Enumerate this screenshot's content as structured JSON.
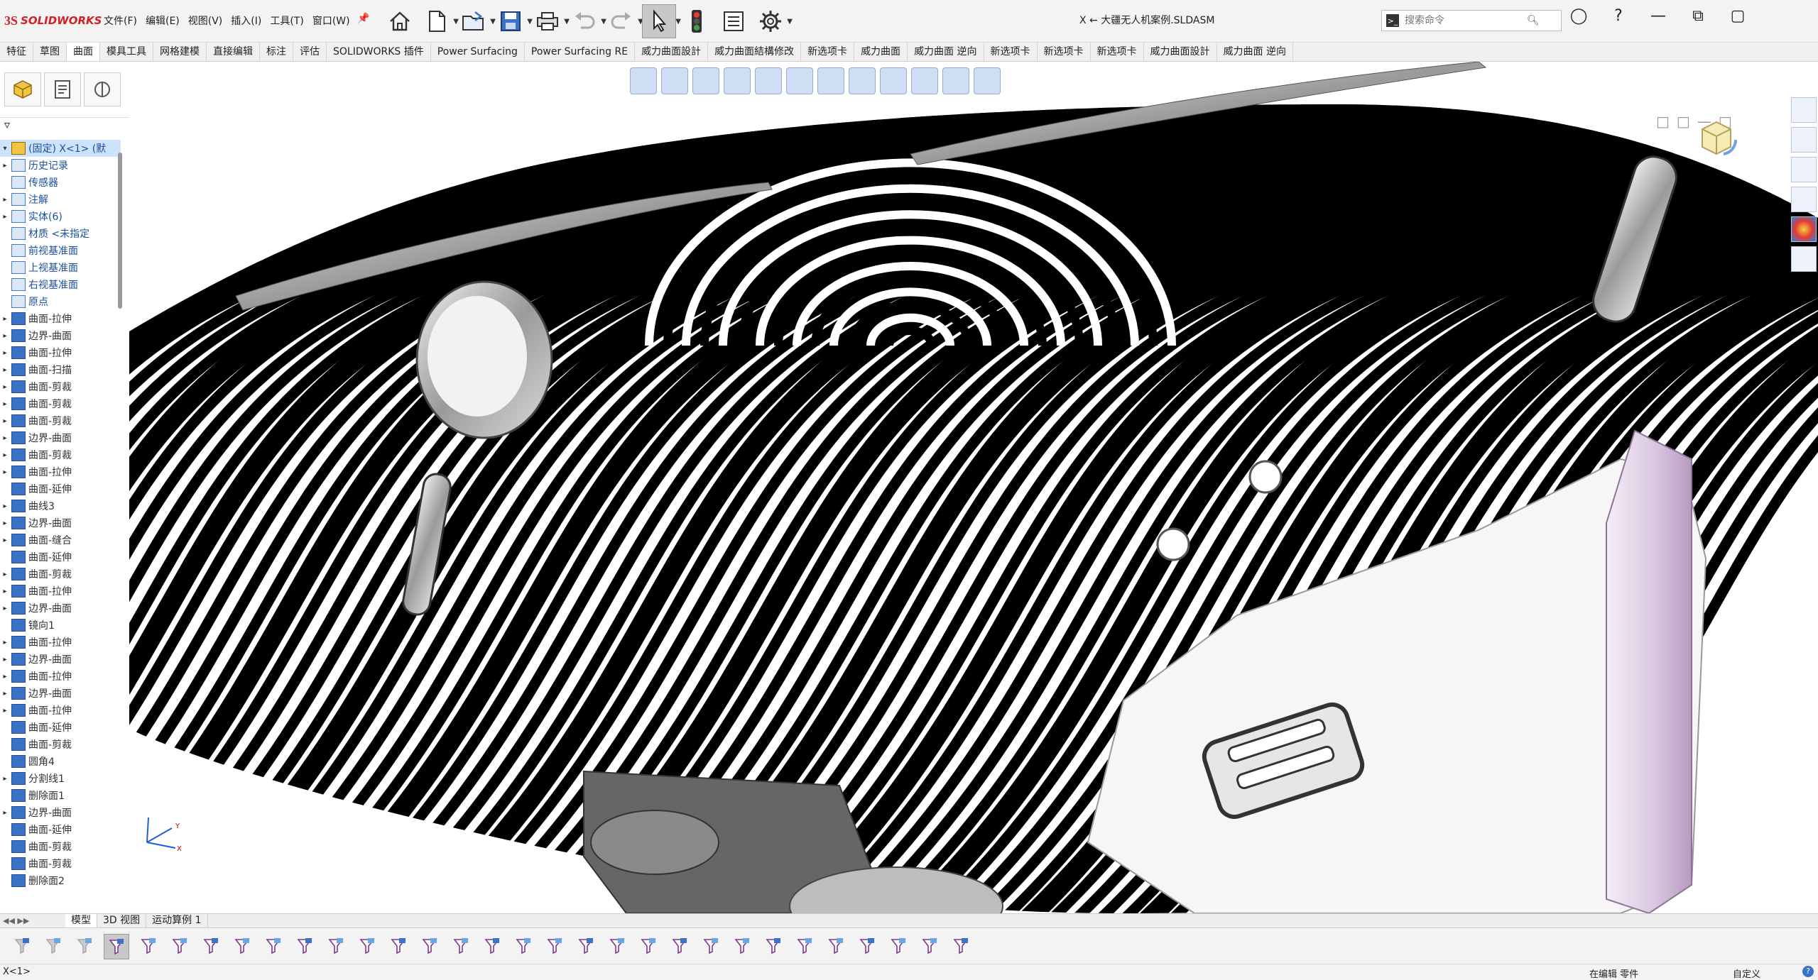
{
  "app": {
    "brand": "SOLIDWORKS",
    "brand_mark": "3S"
  },
  "menu": [
    "文件(F)",
    "编辑(E)",
    "视图(V)",
    "插入(I)",
    "工具(T)",
    "窗口(W)"
  ],
  "toolbar_icons": [
    "home-icon",
    "new-file-icon",
    "open-folder-icon",
    "save-icon",
    "print-icon",
    "undo-icon",
    "redo-icon",
    "select-arrow-icon",
    "traffic-light-icon",
    "options-list-icon",
    "gear-icon"
  ],
  "window": {
    "title": "X ← 大疆无人机案例.SLDASM"
  },
  "search": {
    "placeholder": "搜索命令",
    "prefix": ">_"
  },
  "command_tabs": [
    "特征",
    "草图",
    "曲面",
    "模具工具",
    "网格建模",
    "直接编辑",
    "标注",
    "评估",
    "SOLIDWORKS 插件",
    "Power Surfacing",
    "Power Surfacing RE",
    "威力曲面設計",
    "威力曲面結構修改",
    "新选项卡",
    "威力曲面",
    "威力曲面 逆向",
    "新选项卡",
    "新选项卡",
    "新选项卡",
    "威力曲面設計",
    "威力曲面 逆向"
  ],
  "tree": {
    "root": "(固定) X<1> (默",
    "items": [
      {
        "label": "历史记录",
        "expand": true,
        "kind": "sys"
      },
      {
        "label": "传感器",
        "expand": false,
        "kind": "sys"
      },
      {
        "label": "注解",
        "expand": true,
        "kind": "sys"
      },
      {
        "label": "实体(6)",
        "expand": true,
        "kind": "sys"
      },
      {
        "label": "材质 <未指定",
        "expand": false,
        "kind": "sys"
      },
      {
        "label": "前视基准面",
        "expand": false,
        "kind": "sys"
      },
      {
        "label": "上视基准面",
        "expand": false,
        "kind": "sys"
      },
      {
        "label": "右视基准面",
        "expand": false,
        "kind": "sys"
      },
      {
        "label": "原点",
        "expand": false,
        "kind": "sys"
      },
      {
        "label": "曲面-拉伸",
        "expand": true,
        "kind": "feat"
      },
      {
        "label": "边界-曲面",
        "expand": true,
        "kind": "feat"
      },
      {
        "label": "曲面-拉伸",
        "expand": true,
        "kind": "feat"
      },
      {
        "label": "曲面-扫描",
        "expand": true,
        "kind": "feat"
      },
      {
        "label": "曲面-剪裁",
        "expand": true,
        "kind": "feat"
      },
      {
        "label": "曲面-剪裁",
        "expand": true,
        "kind": "feat"
      },
      {
        "label": "曲面-剪裁",
        "expand": true,
        "kind": "feat"
      },
      {
        "label": "边界-曲面",
        "expand": true,
        "kind": "feat"
      },
      {
        "label": "曲面-剪裁",
        "expand": true,
        "kind": "feat"
      },
      {
        "label": "曲面-拉伸",
        "expand": true,
        "kind": "feat"
      },
      {
        "label": "曲面-延伸",
        "expand": false,
        "kind": "feat"
      },
      {
        "label": "曲线3",
        "expand": true,
        "kind": "feat"
      },
      {
        "label": "边界-曲面",
        "expand": true,
        "kind": "feat"
      },
      {
        "label": "曲面-缝合",
        "expand": true,
        "kind": "feat"
      },
      {
        "label": "曲面-延伸",
        "expand": false,
        "kind": "feat"
      },
      {
        "label": "曲面-剪裁",
        "expand": true,
        "kind": "feat"
      },
      {
        "label": "曲面-拉伸",
        "expand": true,
        "kind": "feat"
      },
      {
        "label": "边界-曲面",
        "expand": true,
        "kind": "feat"
      },
      {
        "label": "镜向1",
        "expand": false,
        "kind": "feat"
      },
      {
        "label": "曲面-拉伸",
        "expand": true,
        "kind": "feat"
      },
      {
        "label": "边界-曲面",
        "expand": true,
        "kind": "feat"
      },
      {
        "label": "曲面-拉伸",
        "expand": true,
        "kind": "feat"
      },
      {
        "label": "边界-曲面",
        "expand": true,
        "kind": "feat"
      },
      {
        "label": "曲面-拉伸",
        "expand": true,
        "kind": "feat"
      },
      {
        "label": "曲面-延伸",
        "expand": false,
        "kind": "feat"
      },
      {
        "label": "曲面-剪裁",
        "expand": false,
        "kind": "feat"
      },
      {
        "label": "圆角4",
        "expand": false,
        "kind": "feat"
      },
      {
        "label": "分割线1",
        "expand": true,
        "kind": "feat"
      },
      {
        "label": "删除面1",
        "expand": false,
        "kind": "feat"
      },
      {
        "label": "边界-曲面",
        "expand": true,
        "kind": "feat"
      },
      {
        "label": "曲面-延伸",
        "expand": false,
        "kind": "feat"
      },
      {
        "label": "曲面-剪裁",
        "expand": false,
        "kind": "feat"
      },
      {
        "label": "曲面-剪裁",
        "expand": false,
        "kind": "feat"
      },
      {
        "label": "删除面2",
        "expand": false,
        "kind": "feat"
      }
    ]
  },
  "bottom_tabs": [
    "模型",
    "3D 视图",
    "运动算例 1"
  ],
  "status": {
    "left": "X<1>",
    "mode": "在编辑 零件",
    "custom": "自定义",
    "help": "?"
  }
}
